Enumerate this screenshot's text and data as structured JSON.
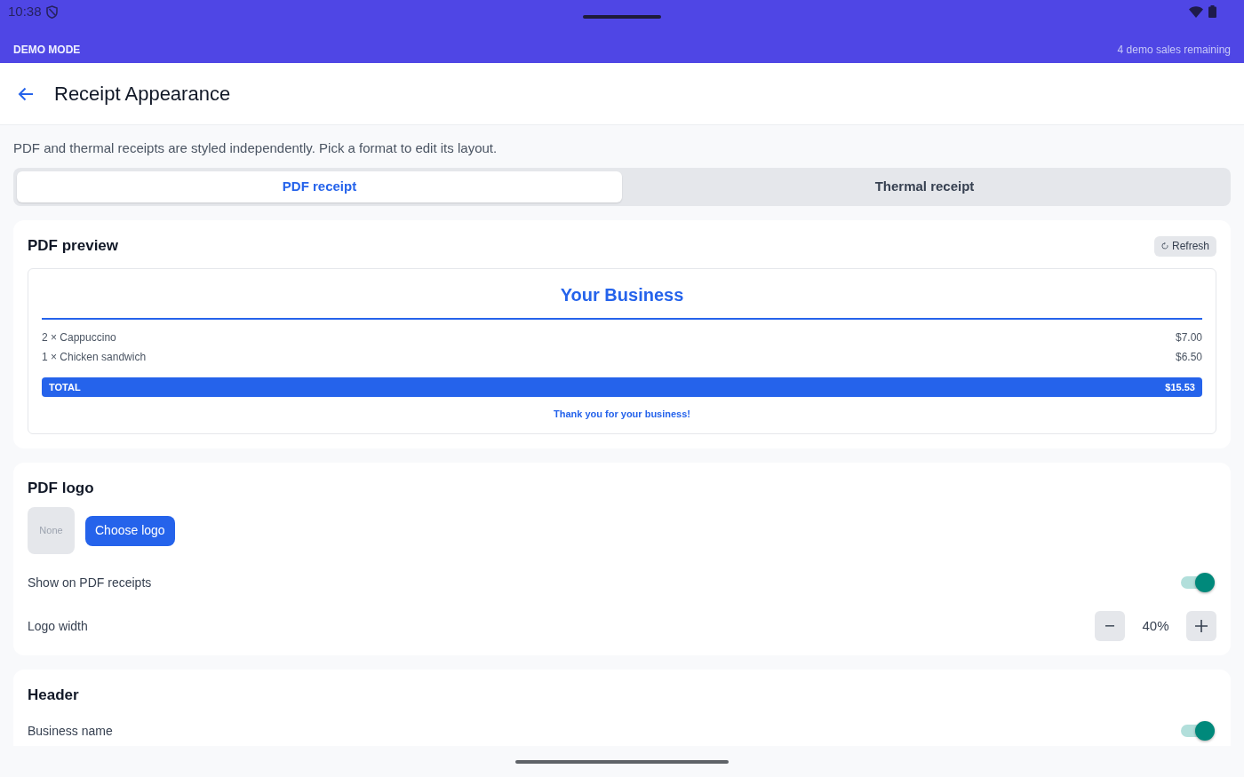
{
  "status_bar": {
    "time": "10:38"
  },
  "demo_banner": {
    "label": "DEMO MODE",
    "remaining": "4 demo sales remaining"
  },
  "app_bar": {
    "title": "Receipt Appearance"
  },
  "intro": "PDF and thermal receipts are styled independently. Pick a format to edit its layout.",
  "format_tabs": [
    {
      "label": "PDF receipt",
      "selected": true
    },
    {
      "label": "Thermal receipt",
      "selected": false
    }
  ],
  "preview_card": {
    "title": "PDF preview",
    "refresh_button": "Refresh",
    "receipt": {
      "business_name": "Your Business",
      "items": [
        {
          "description": "2 × Cappuccino",
          "amount": "$7.00"
        },
        {
          "description": "1 × Chicken sandwich",
          "amount": "$6.50"
        }
      ],
      "total_label": "TOTAL",
      "total_amount": "$15.53",
      "footer": "Thank you for your business!"
    }
  },
  "logo_card": {
    "title": "PDF logo",
    "logo_placeholder": "None",
    "choose_button": "Choose logo",
    "rows": [
      {
        "kind": "toggle",
        "label": "Show on PDF receipts",
        "on": true
      },
      {
        "kind": "stepper",
        "label": "Logo width",
        "value": "40%"
      }
    ]
  },
  "header_card": {
    "title": "Header",
    "rows": [
      {
        "kind": "toggle",
        "label": "Business name",
        "on": true
      }
    ]
  }
}
